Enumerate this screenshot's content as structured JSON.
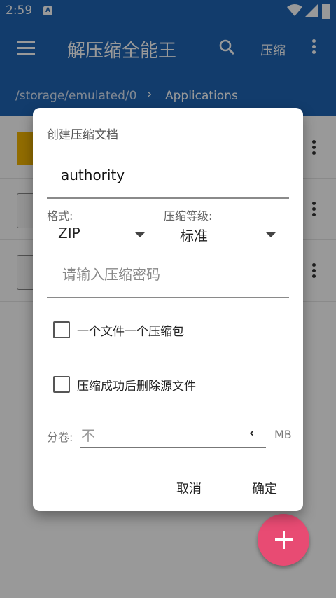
{
  "status_bar": {
    "time": "2:59",
    "badge": "A"
  },
  "app_bar": {
    "title": "解压缩全能王",
    "compress_label": "压缩"
  },
  "breadcrumb": {
    "path": "/storage/emulated/0",
    "separator": "›",
    "folder": "Applications"
  },
  "list": {
    "rows": [
      "folder",
      "file",
      "file"
    ]
  },
  "dialog": {
    "title": "创建压缩文档",
    "archive_name": "authority",
    "format_label": "格式:",
    "format_value": "ZIP",
    "level_label": "压缩等级:",
    "level_value": "标准",
    "password_placeholder": "请输入压缩密码",
    "option_per_file": "一个文件一个压缩包",
    "option_delete_source": "压缩成功后删除源文件",
    "split_label": "分卷:",
    "split_value": "不",
    "split_arrow": "‹",
    "split_unit": "MB",
    "cancel_label": "取消",
    "confirm_label": "确定"
  },
  "colors": {
    "app_bar": "#1f65b4",
    "fab": "#e84b73",
    "folder": "#f2b400"
  }
}
